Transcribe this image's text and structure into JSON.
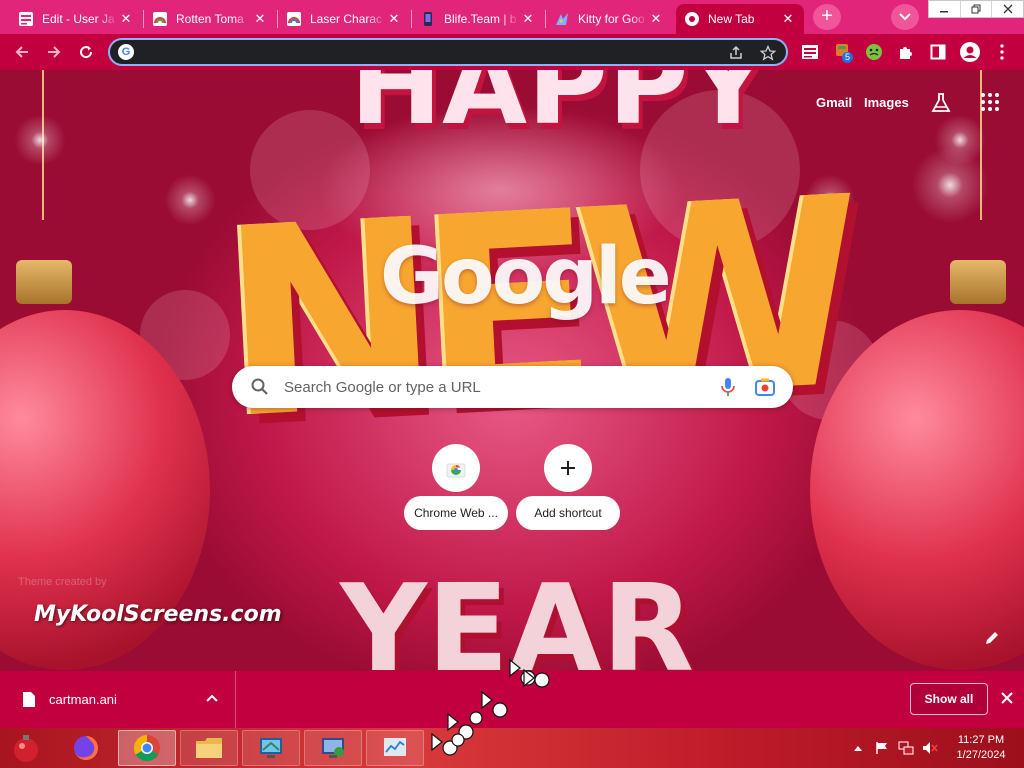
{
  "browser": {
    "tabs": [
      {
        "title": "Edit - User Ja",
        "icon": "edit-page-icon",
        "active": false
      },
      {
        "title": "Rotten Toma",
        "icon": "rainbow-icon",
        "active": false
      },
      {
        "title": "Laser Charac",
        "icon": "rainbow-icon",
        "active": false
      },
      {
        "title": "Blife.Team | b",
        "icon": "phone-icon",
        "active": false
      },
      {
        "title": "Kitty for Goo",
        "icon": "kitty-icon",
        "active": false
      },
      {
        "title": "New Tab",
        "icon": "chrome-icon",
        "active": true
      }
    ],
    "new_tab_symbol": "+",
    "address": {
      "value": "",
      "placeholder": ""
    },
    "extension_badge": "5"
  },
  "ntp": {
    "top_links": {
      "gmail": "Gmail",
      "images": "Images"
    },
    "logo_text": "Google",
    "search": {
      "placeholder": "Search Google or type a URL",
      "value": ""
    },
    "shortcuts": [
      {
        "label": "Chrome Web ...",
        "icon": "chrome-web-store-icon"
      },
      {
        "label": "Add shortcut",
        "icon": "plus-icon"
      }
    ],
    "theme_credit": "Theme created by",
    "watermark": "MyKoolScreens.com",
    "background_words": {
      "line1": "HAPPY",
      "line2": "NEW",
      "line3": "YEAR"
    }
  },
  "download_bar": {
    "file_name": "cartman.ani",
    "show_all_label": "Show all"
  },
  "taskbar": {
    "apps": [
      "start-orb-icon",
      "firefox-icon",
      "chrome-icon",
      "file-explorer-icon",
      "network-app-icon",
      "remote-desktop-icon",
      "task-manager-icon"
    ],
    "clock": {
      "time": "11:27 PM",
      "date": "1/27/2024"
    }
  },
  "colors": {
    "tabstrip": "#e0257a",
    "toolbar": "#c2003f",
    "accent_focus": "#8ab4f8",
    "download_bar": "#c2003f"
  }
}
